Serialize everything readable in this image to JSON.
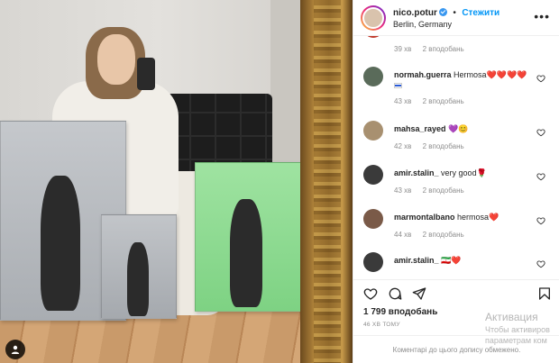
{
  "post": {
    "username": "nico.potur",
    "follow_label": "Стежити",
    "location": "Berlin, Germany",
    "separator": "•"
  },
  "comments": [
    {
      "username": "",
      "text": "",
      "time": "39 хв",
      "likes": "2 вподобань"
    },
    {
      "username": "normah.guerra",
      "text": "Hermosa",
      "emoji": "❤️❤️❤️❤️",
      "time": "43 хв",
      "likes": "2 вподобань"
    },
    {
      "username": "mahsa_rayed",
      "text": "",
      "emoji": "💜😊",
      "time": "42 хв",
      "likes": "2 вподобань"
    },
    {
      "username": "amir.stalin_",
      "text": "very good",
      "emoji": "🌹",
      "time": "43 хв",
      "likes": "2 вподобань"
    },
    {
      "username": "marmontalbano",
      "text": "hermosa",
      "emoji": "❤️",
      "time": "44 хв",
      "likes": "2 вподобань"
    },
    {
      "username": "amir.stalin_",
      "text": "",
      "emoji": "🇮🇷❤️",
      "time": "",
      "likes": ""
    }
  ],
  "footer": {
    "likes": "1 799 вподобань",
    "time_ago": "46 ХВ ТОМУ",
    "add_comment_placeholder": "Коментарі до цього допису обмежено."
  },
  "watermark": {
    "line1": "Активация",
    "line2": "Чтобы активиров",
    "line3": "параметрам ком"
  },
  "icons": {
    "header_more": "more-horizontal-icon",
    "comment_like": "heart-outline-icon",
    "action_like": "heart-outline-icon",
    "action_comment": "comment-icon",
    "action_share": "send-icon",
    "action_save": "bookmark-icon",
    "photo_account": "user-tag-icon"
  },
  "colors": {
    "accent": "#0095f6",
    "verified": "#3897f0",
    "text": "#262626",
    "muted": "#8e8e8e"
  }
}
